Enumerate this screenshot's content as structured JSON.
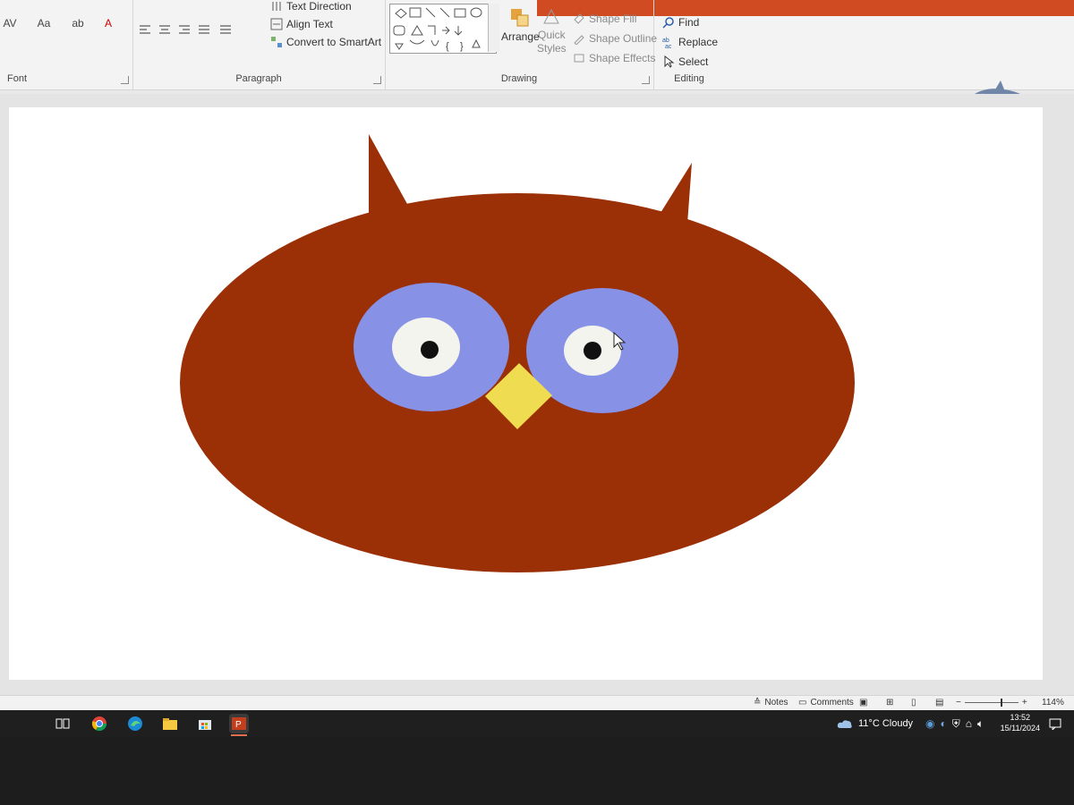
{
  "ribbon": {
    "font_group_label": "Font",
    "paragraph_group_label": "Paragraph",
    "drawing_group_label": "Drawing",
    "editing_group_label": "Editing",
    "text_direction": "Text Direction",
    "align_text": "Align Text",
    "convert_smartart": "Convert to SmartArt",
    "arrange": "Arrange",
    "quick_styles_line1": "Quick",
    "quick_styles_line2": "Styles",
    "shape_fill": "Shape Fill",
    "shape_outline": "Shape Outline",
    "shape_effects": "Shape Effects",
    "find": "Find",
    "replace": "Replace",
    "select": "Select"
  },
  "status": {
    "notes": "Notes",
    "comments": "Comments",
    "zoom": "114%"
  },
  "taskbar": {
    "weather": "11°C  Cloudy",
    "time": "13:52",
    "date": "15/11/2024"
  },
  "colors": {
    "owl_body": "#9b2f06",
    "owl_eye_outer": "#8791e6",
    "owl_eye_white": "#f4f4ee",
    "owl_pupil": "#111111",
    "beak": "#f0dc50",
    "accent": "#d04a22"
  }
}
